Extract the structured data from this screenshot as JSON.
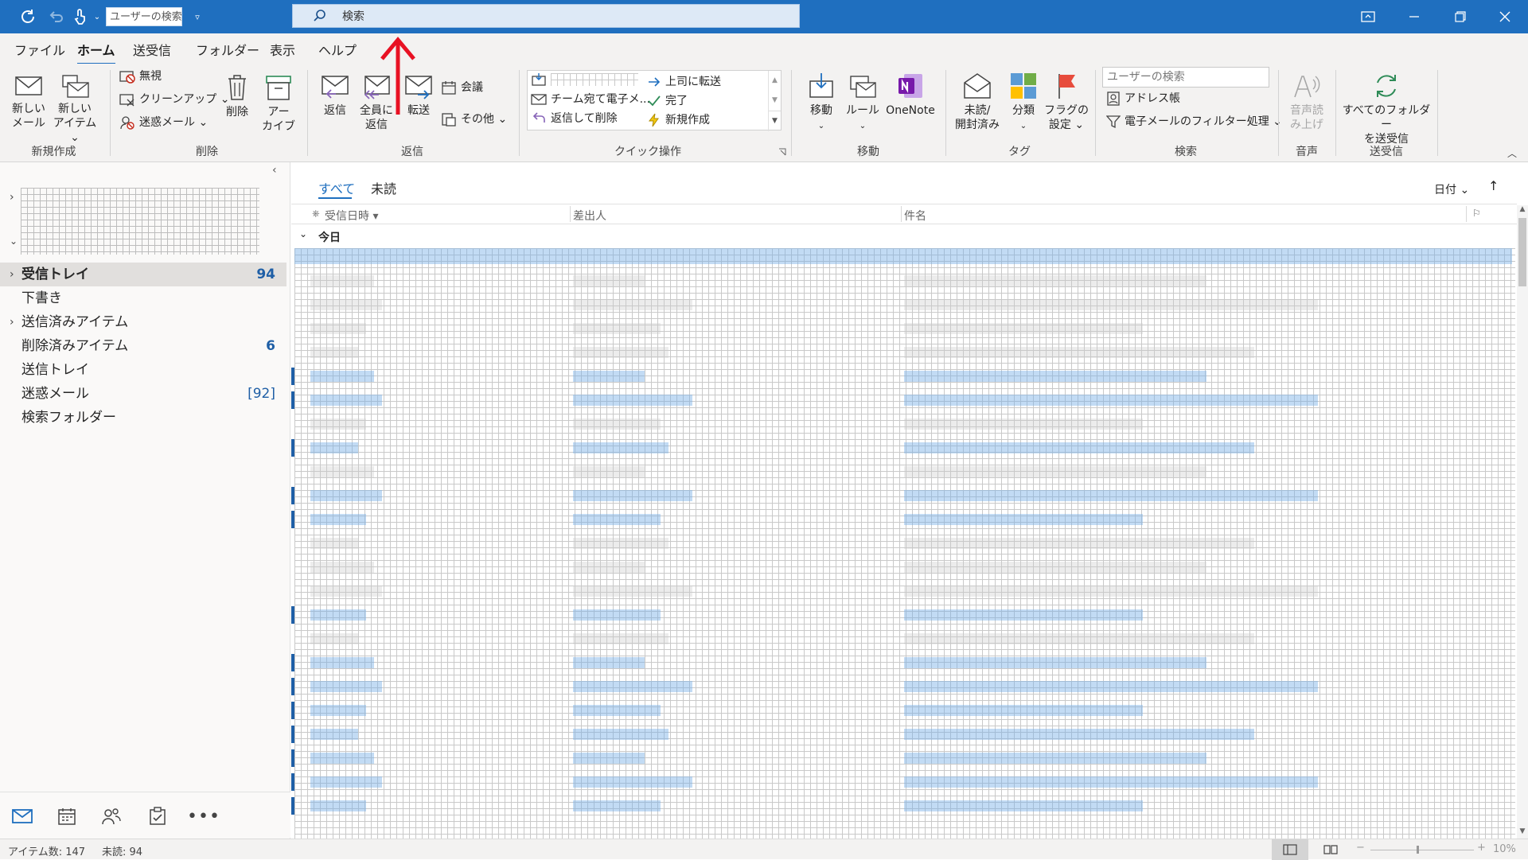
{
  "title_bar": {
    "user_search_placeholder": "ユーザーの検索",
    "search_placeholder": "検索"
  },
  "menu": {
    "items": [
      "ファイル",
      "ホーム",
      "送受信",
      "フォルダー",
      "表示",
      "ヘルプ"
    ],
    "active_index": 1
  },
  "ribbon": {
    "new": {
      "new_mail": [
        "新しい",
        "メール"
      ],
      "new_item": [
        "新しい",
        "アイテム ⌄"
      ],
      "group": "新規作成"
    },
    "delete": {
      "ignore": "無視",
      "cleanup": "クリーンアップ ⌄",
      "junk": "迷惑メール ⌄",
      "delete": "削除",
      "archive": [
        "アー",
        "カイブ"
      ],
      "group": "削除"
    },
    "respond": {
      "reply": "返信",
      "reply_all": [
        "全員に",
        "返信"
      ],
      "forward": "転送",
      "meeting": "会議",
      "more": "その他 ⌄",
      "group": "返信"
    },
    "quick_steps": {
      "forward_manager": "上司に転送",
      "team_email": "チーム宛て電子メ...",
      "done": "完了",
      "reply_delete": "返信して削除",
      "create_new": "新規作成",
      "group": "クイック操作"
    },
    "move": {
      "move": "移動",
      "rules": "ルール",
      "onenote": "OneNote",
      "group": "移動"
    },
    "tags": {
      "unread_read": [
        "未読/",
        "開封済み"
      ],
      "categorize": "分類",
      "follow_up": [
        "フラグの",
        "設定 ⌄"
      ],
      "group": "タグ"
    },
    "find": {
      "search_people_placeholder": "ユーザーの検索",
      "address_book": "アドレス帳",
      "filter_email": "電子メールのフィルター処理 ⌄",
      "group": "検索"
    },
    "speech": {
      "read_aloud": [
        "音声読",
        "み上げ"
      ],
      "group": "音声"
    },
    "send_receive": {
      "send_receive_all": [
        "すべてのフォルダー",
        "を送受信"
      ],
      "group": "送受信"
    }
  },
  "folders": [
    {
      "label": "受信トレイ",
      "count": "94",
      "bold": true,
      "chevron": true
    },
    {
      "label": "下書き",
      "count": "",
      "bold": false,
      "chevron": false
    },
    {
      "label": "送信済みアイテム",
      "count": "",
      "bold": false,
      "chevron": true
    },
    {
      "label": "削除済みアイテム",
      "count": "6",
      "bold": false,
      "chevron": false
    },
    {
      "label": "送信トレイ",
      "count": "",
      "bold": false,
      "chevron": false
    },
    {
      "label": "迷惑メール",
      "count": "[92]",
      "bold": false,
      "chevron": false
    },
    {
      "label": "検索フォルダー",
      "count": "",
      "bold": false,
      "chevron": false
    }
  ],
  "mail_list": {
    "tabs": [
      "すべて",
      "未読"
    ],
    "active_tab": 0,
    "sort_label": "日付 ⌄",
    "sort_arrow": "↑",
    "columns": {
      "received": "受信日時 ▾",
      "from": "差出人",
      "subject": "件名"
    },
    "group_today": "今日"
  },
  "status_bar": {
    "items": "アイテム数: 147",
    "unread": "未読: 94",
    "zoom": "10%"
  },
  "colors": {
    "accent": "#1f6fbf",
    "count_blue": "#1f5fa6",
    "annotation_arrow": "#e81123"
  }
}
